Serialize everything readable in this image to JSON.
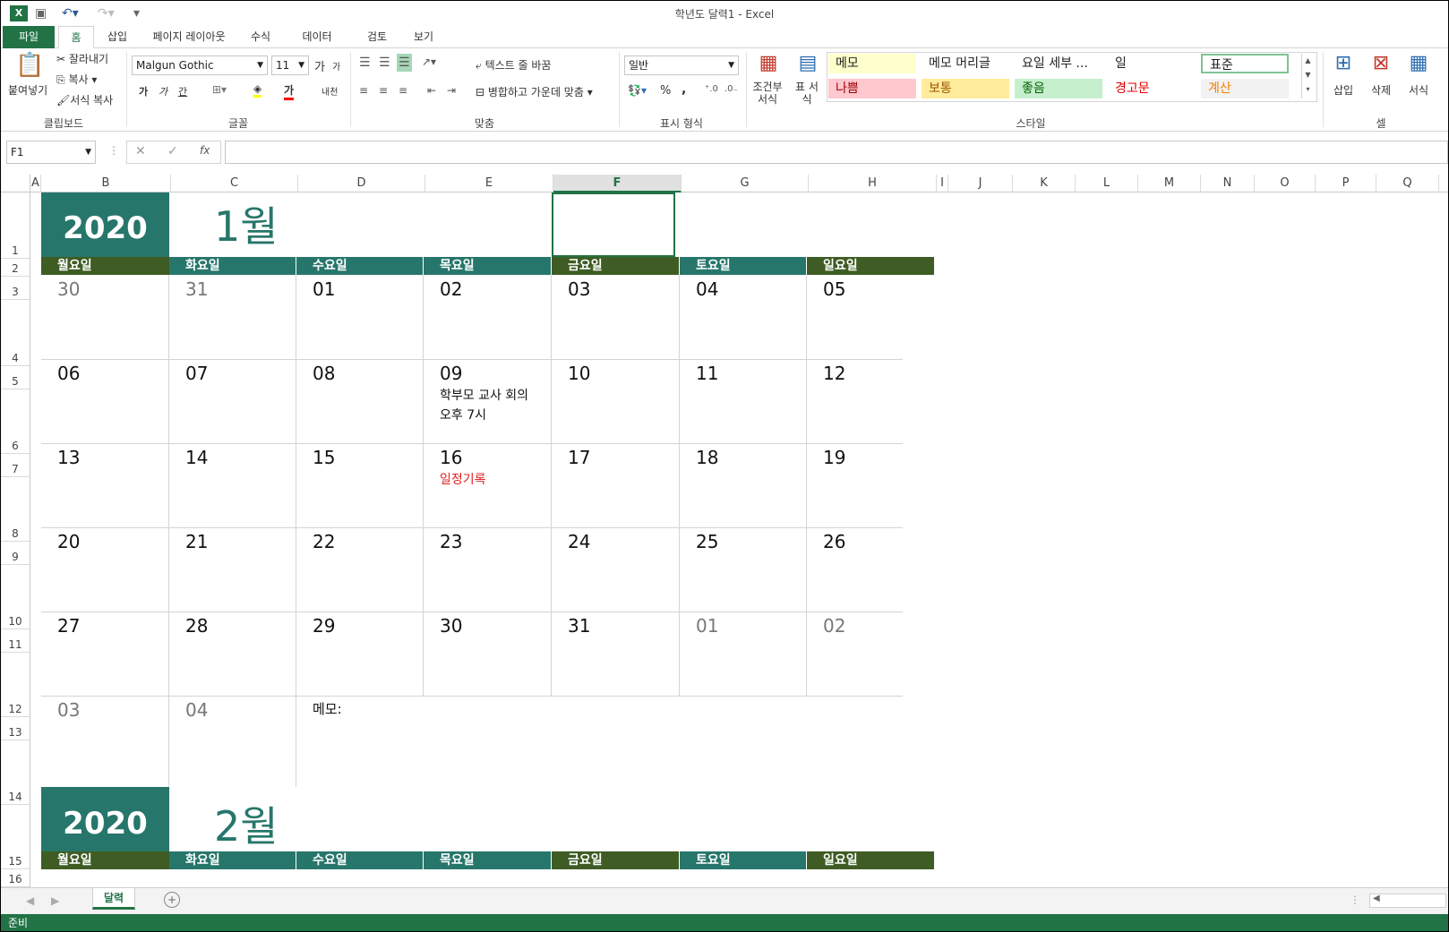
{
  "window": {
    "title": "학년도 달력1 - Excel"
  },
  "tabs": [
    "파일",
    "홈",
    "삽입",
    "페이지 레이아웃",
    "수식",
    "데이터",
    "검토",
    "보기"
  ],
  "ribbon": {
    "clipboard": {
      "paste": "붙여넣기",
      "cut": "잘라내기",
      "copy": "복사",
      "format_painter": "서식 복사",
      "group": "클립보드"
    },
    "font": {
      "name": "Malgun Gothic",
      "size": "11",
      "group": "글꼴",
      "grow": "가",
      "shrink": "가",
      "bold": "가",
      "italic": "가",
      "underline": "간",
      "color_glyph": "가",
      "phonetic": "내천"
    },
    "alignment": {
      "wrap": "텍스트 줄 바꿈",
      "merge": "병합하고 가운데 맞춤",
      "group": "맞춤"
    },
    "number": {
      "format": "일반",
      "percent": "%",
      "comma": ",",
      "group": "표시 형식"
    },
    "styles": {
      "conditional": "조건부 서식",
      "table": "표 서식",
      "items": [
        {
          "label": "메모",
          "bg": "#ffffcc",
          "color": "#222"
        },
        {
          "label": "메모 머리글",
          "bg": "#ffffff",
          "color": "#222"
        },
        {
          "label": "요일 세부 ...",
          "bg": "#ffffff",
          "color": "#222"
        },
        {
          "label": "일",
          "bg": "#ffffff",
          "color": "#222"
        },
        {
          "label": "표준",
          "bg": "#ffffff",
          "color": "#222"
        },
        {
          "label": "나쁨",
          "bg": "#ffc7ce",
          "color": "#9c0006"
        },
        {
          "label": "보통",
          "bg": "#ffeb9c",
          "color": "#9c5700"
        },
        {
          "label": "좋음",
          "bg": "#c6efce",
          "color": "#006100"
        },
        {
          "label": "경고문",
          "bg": "#ffffff",
          "color": "#e00000"
        },
        {
          "label": "계산",
          "bg": "#f2f2f2",
          "color": "#fa7d00"
        }
      ],
      "group": "스타일"
    },
    "cells": {
      "insert": "삽입",
      "delete": "삭제",
      "format": "서식",
      "group": "셀"
    }
  },
  "formula_bar": {
    "name_box": "F1",
    "value": "",
    "fx": "fx"
  },
  "columns": [
    "A",
    "B",
    "C",
    "D",
    "E",
    "F",
    "G",
    "H",
    "I",
    "J",
    "K",
    "L",
    "M",
    "N",
    "O",
    "P",
    "Q"
  ],
  "rows": [
    "1",
    "2",
    "3",
    "4",
    "5",
    "6",
    "7",
    "8",
    "9",
    "10",
    "11",
    "12",
    "13",
    "14",
    "15",
    "16"
  ],
  "calendar": {
    "year": "2020",
    "month": "1월",
    "weekdays": [
      "월요일",
      "화요일",
      "수요일",
      "목요일",
      "금요일",
      "토요일",
      "일요일"
    ],
    "weeks": [
      [
        "30",
        "31",
        "01",
        "02",
        "03",
        "04",
        "05"
      ],
      [
        "06",
        "07",
        "08",
        "09",
        "10",
        "11",
        "12"
      ],
      [
        "13",
        "14",
        "15",
        "16",
        "17",
        "18",
        "19"
      ],
      [
        "20",
        "21",
        "22",
        "23",
        "24",
        "25",
        "26"
      ],
      [
        "27",
        "28",
        "29",
        "30",
        "31",
        "01",
        "02"
      ],
      [
        "03",
        "04",
        "메모:",
        "",
        "",
        "",
        ""
      ]
    ],
    "events": {
      "meeting_line1": "학부모 교사 회의",
      "meeting_line2": "오후 7시",
      "note": "일정기록"
    },
    "next_year": "2020",
    "next_month": "2월"
  },
  "sheet_tab": "달력",
  "status": "준비",
  "colors": {
    "teal": "#27766b",
    "olive": "#3e5c24",
    "excel_green": "#217346"
  }
}
